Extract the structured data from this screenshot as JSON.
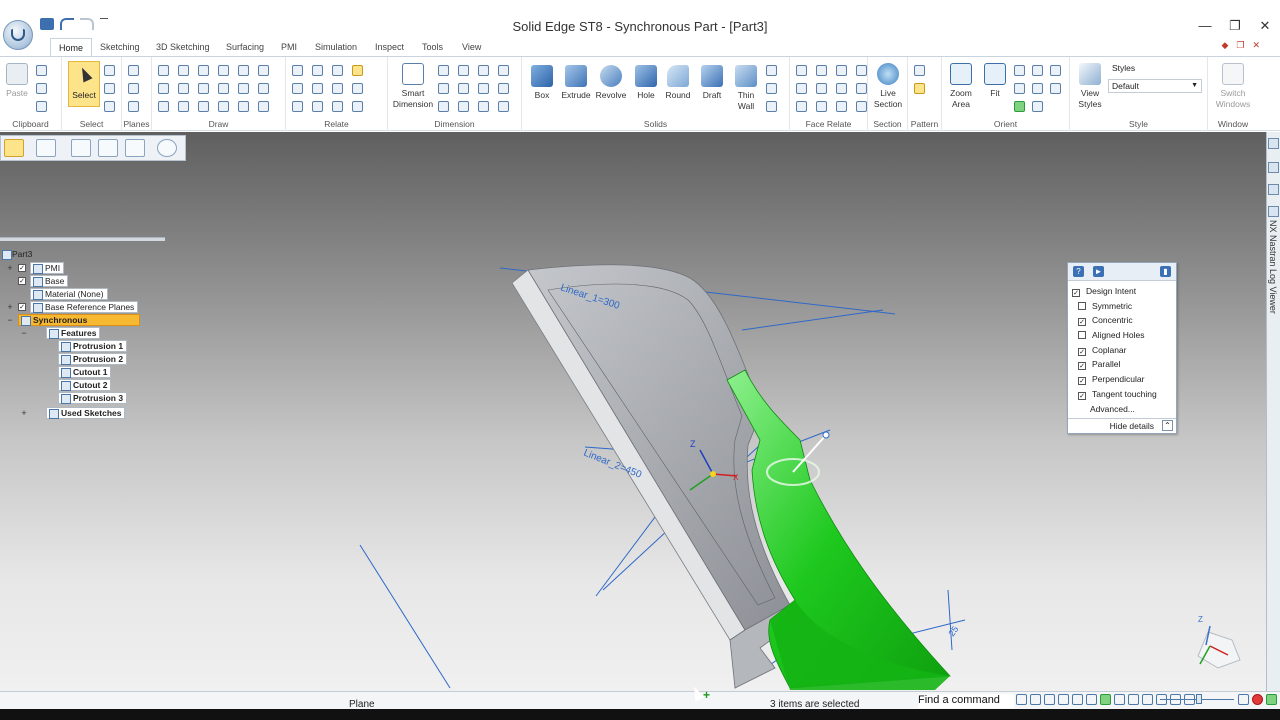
{
  "window": {
    "title": "Solid Edge ST8 - Synchronous Part - [Part3]",
    "controls": [
      "—",
      "❐",
      "✕"
    ]
  },
  "tabs": [
    "Home",
    "Sketching",
    "3D Sketching",
    "Surfacing",
    "PMI",
    "Simulation",
    "Inspect",
    "Tools",
    "View"
  ],
  "active_tab": "Home",
  "ribbon": {
    "groups": [
      "Clipboard",
      "Select",
      "Planes",
      "Draw",
      "Relate",
      "Dimension",
      "Solids",
      "Face Relate",
      "Section",
      "Pattern",
      "Orient",
      "Style",
      "Window"
    ],
    "paste": "Paste",
    "select": "Select",
    "smart_dimension": [
      "Smart",
      "Dimension"
    ],
    "solids": [
      "Box",
      "Extrude",
      "Revolve",
      "Hole",
      "Round",
      "Draft"
    ],
    "thin_wall": [
      "Thin",
      "Wall"
    ],
    "live_section": [
      "Live",
      "Section"
    ],
    "zoom_area": [
      "Zoom",
      "Area"
    ],
    "fit": "Fit",
    "view_styles": [
      "View",
      "Styles"
    ],
    "styles_label": "Styles",
    "styles_value": "Default",
    "switch_windows": [
      "Switch",
      "Windows"
    ]
  },
  "tree": {
    "root": "Part3",
    "items": [
      "PMI",
      "Base",
      "Material (None)",
      "Base Reference Planes",
      "Synchronous",
      "Features",
      "Protrusion 1",
      "Protrusion 2",
      "Cutout 1",
      "Cutout 2",
      "Protrusion 3",
      "Used Sketches"
    ]
  },
  "design_intent": {
    "title": "Design Intent",
    "options": [
      {
        "label": "Symmetric",
        "checked": false
      },
      {
        "label": "Concentric",
        "checked": true
      },
      {
        "label": "Aligned Holes",
        "checked": false
      },
      {
        "label": "Coplanar",
        "checked": true
      },
      {
        "label": "Parallel",
        "checked": true
      },
      {
        "label": "Perpendicular",
        "checked": true
      },
      {
        "label": "Tangent touching",
        "checked": true
      }
    ],
    "advanced": "Advanced...",
    "hide_details": "Hide details"
  },
  "viewport": {
    "dim_linear_1": "Linear_1=300",
    "dim_linear_2": "Linear_2=450",
    "dim_small": "25",
    "axis_x": "X",
    "axis_z": "Z",
    "cube_z": "Z"
  },
  "side_panel": {
    "title": "NX Nastran Log Viewer"
  },
  "status": {
    "prompt": "Plane",
    "selection": "3 items are selected",
    "find_command": "Find a command"
  },
  "colors": {
    "accent": "#f7b832",
    "selection_green": "#1ec81e",
    "dimension_blue": "#2f68c8",
    "part_gray": "#a9adb3"
  }
}
